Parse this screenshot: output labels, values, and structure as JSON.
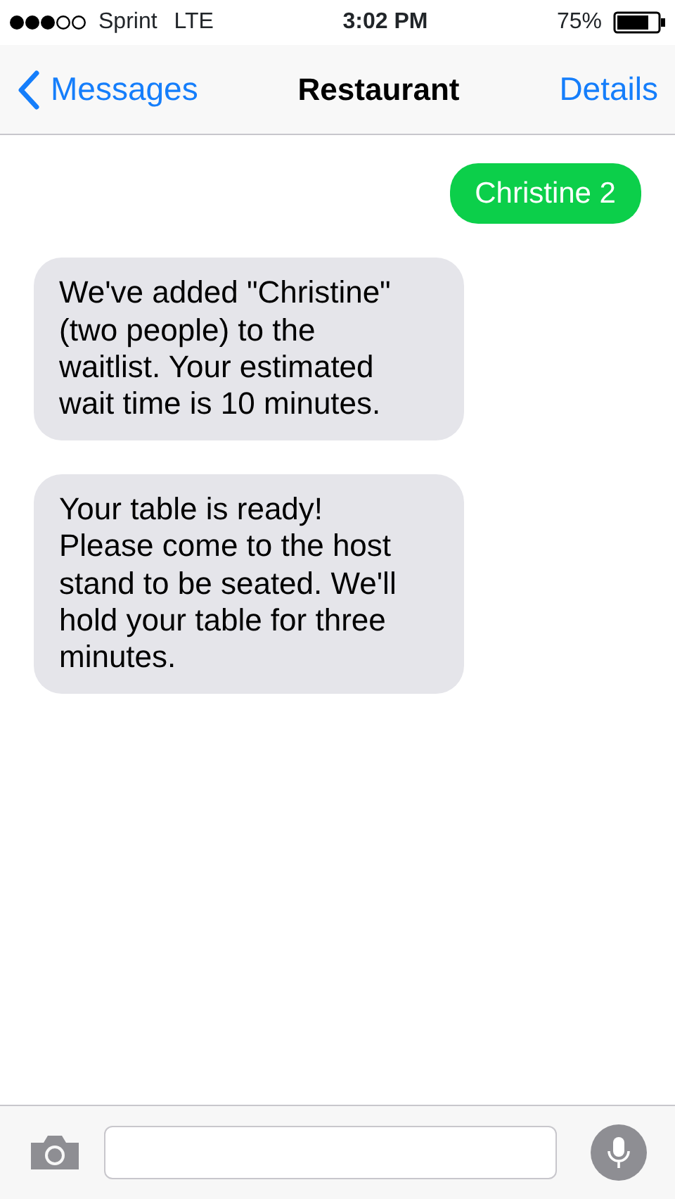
{
  "status_bar": {
    "carrier": "Sprint",
    "network": "LTE",
    "time": "3:02 PM",
    "battery_percent": "75%"
  },
  "nav": {
    "back": "Messages",
    "title": "Restaurant",
    "action": "Details"
  },
  "messages": [
    {
      "kind": "sent",
      "text": "Christine 2"
    },
    {
      "kind": "received",
      "text": "We've added \"Christine\" (two people) to the waitlist. Your estimated wait time is 10 minutes."
    },
    {
      "kind": "received",
      "text": "Your table is ready! Please come to the host stand to be seated. We'll hold your table for three minutes."
    }
  ]
}
